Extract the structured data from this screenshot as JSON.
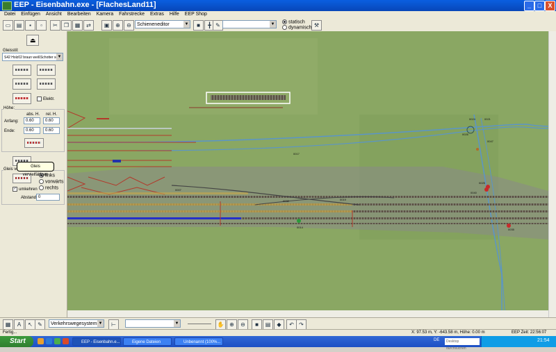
{
  "window": {
    "title": "EEP - Eisenbahn.exe - [FlachesLand11]",
    "controls": [
      "_",
      "□",
      "X"
    ]
  },
  "menu": [
    "Datei",
    "Einfügen",
    "Ansicht",
    "Bearbeiten",
    "Kamera",
    "Fahrstrecke",
    "Extras",
    "Hilfe",
    "EEP Shop"
  ],
  "toolbar": {
    "editor_select": "Schieneneditor",
    "second_select": "",
    "radio_statisch": "statisch",
    "radio_dynamisch": "dynamisch"
  },
  "left_panel": {
    "gleisstil_label": "Gleisstil:",
    "gleisstil_value": "S42 Holz02 braun weißSchotter sc",
    "elektr_label": "Elektr.",
    "hoehe_label": "Höhe:",
    "col_abs": "abs. H.",
    "col_rel": "rel. H.",
    "anfang_label": "Anfang:",
    "ende_label": "Ende:",
    "anfang_abs": "0.60",
    "anfang_rel": "0.60",
    "ende_abs": "0.60",
    "ende_rel": "0.60",
    "gleis_ver_label": "Gleis ver",
    "tooltip": "Gleis vervielfältigen",
    "radio_links": "links",
    "radio_vorwaerts": "vorwärts",
    "radio_rechts": "rechts",
    "umkehren_label": "umkehren",
    "abstand_label": "Abstand:",
    "abstand_value": "0"
  },
  "scene": {
    "labels": [
      "0024",
      "0021",
      "0026",
      "0047",
      "0017",
      "0025",
      "0040",
      "0032",
      "0019",
      "0007",
      "0035",
      "0014"
    ],
    "colors": {
      "grass": "#8aa763",
      "track_blue": "#5a95c9",
      "track_red": "#b3382a"
    }
  },
  "bottom_toolbar": {
    "system_select": "Verkehrswegesystem"
  },
  "statusbar": {
    "left": "Fertig...",
    "coords": "X: 97.53 m,  Y: -643.58 m, Höhe: 0.00 m",
    "time": "EEP Zeit: 22:56:07"
  },
  "taskbar": {
    "start": "Start",
    "tasks": [
      "EEP - Eisenbahn.e...",
      "Eigene Dateien",
      "Unbenannt (100%..."
    ],
    "lang": "DE",
    "search_placeholder": "Desktop durchsuchen",
    "clock": "21:54"
  }
}
